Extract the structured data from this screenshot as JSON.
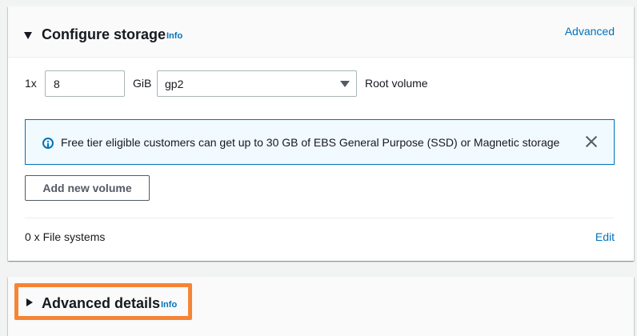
{
  "storage": {
    "title": "Configure storage",
    "info": "Info",
    "advanced_link": "Advanced",
    "quantity": "1x",
    "size_value": "8",
    "unit": "GiB",
    "volume_type": "gp2",
    "volume_label": "Root volume",
    "alert_text": "Free tier eligible customers can get up to 30 GB of EBS General Purpose (SSD) or Magnetic storage",
    "add_volume_button": "Add new volume",
    "file_systems": "0 x File systems",
    "edit_link": "Edit"
  },
  "advanced": {
    "title": "Advanced details",
    "info": "Info",
    "highlight_color": "#f58536"
  },
  "colors": {
    "link": "#0073bb",
    "alert_background": "#f1faff"
  },
  "icons": {
    "expand": "caret-down-icon",
    "collapsed": "caret-right-icon",
    "alert": "info-circle-icon",
    "dismiss": "close-icon"
  }
}
